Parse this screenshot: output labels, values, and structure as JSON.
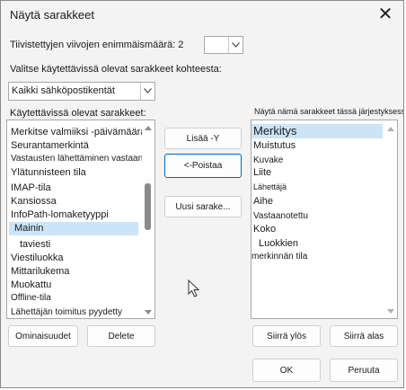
{
  "dialog": {
    "title": "Näytä sarakkeet"
  },
  "max_lines": {
    "label": "Tiivistettyjen viivojen enimmäismäärä: 2"
  },
  "source": {
    "label": "Valitse käytettävissä olevat sarakkeet kohteesta:",
    "selected": "Kaikki sähköpostikentät"
  },
  "available": {
    "label": "Käytettävissä olevat sarakkeet:",
    "items": [
      "Merkitse valmiiksi -päivämäärä",
      "Seurantamerkintä",
      "Vastausten lähettäminen vastaanottajalle",
      "Ylätunnisteen tila",
      "IMAP-tila",
      "Kansiossa",
      "InfoPath-lomaketyyppi",
      "Mainin",
      "taviesti",
      "Viestiluokka",
      "Mittarilukema",
      "Muokattu",
      "Offline-tila",
      "Lähettäjän toimitus pyydetty"
    ],
    "selected_index": 7
  },
  "shown": {
    "label": "Näytä nämä sarakkeet tässä järjestyksessä:",
    "items": [
      "Merkitys",
      "Muistutus",
      "Kuvake",
      "Liite",
      "Lähettäjä",
      "Aihe",
      "Vastaanotettu",
      "Koko",
      "Luokkien",
      "merkinnän tila"
    ],
    "selected_index": 0
  },
  "buttons": {
    "add": "Lisää -Y",
    "remove": "<-Poistaa",
    "new_column": "Uusi sarake...",
    "properties": "Ominaisuudet",
    "delete": "Delete",
    "move_up": "Siirrä ylös",
    "move_down": "Siirrä alas",
    "ok": "OK",
    "cancel": "Peruuta"
  },
  "icons": {
    "close": "close-icon",
    "dropdown": "chevron-down-icon",
    "pointer": "mouse-pointer-icon"
  }
}
